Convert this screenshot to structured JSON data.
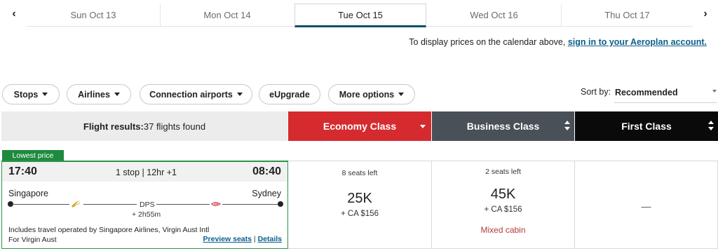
{
  "dates": {
    "prev_icon": "chevron-left-icon",
    "next_icon": "chevron-right-icon",
    "tabs": [
      {
        "label": "Sun Oct 13"
      },
      {
        "label": "Mon Oct 14"
      },
      {
        "label": "Tue Oct 15"
      },
      {
        "label": "Wed Oct 16"
      },
      {
        "label": "Thu Oct 17"
      }
    ],
    "active_index": 2
  },
  "signin": {
    "prefix": "To display prices on the calendar above, ",
    "link": "sign in to your Aeroplan account."
  },
  "filters": {
    "stops": "Stops",
    "airlines": "Airlines",
    "connection": "Connection airports",
    "eupgrade": "eUpgrade",
    "more": "More options"
  },
  "sort": {
    "label": "Sort by:",
    "value": "Recommended"
  },
  "header": {
    "results_label": "Flight results:",
    "results_count": "37 flights found",
    "economy": "Economy Class",
    "business": "Business Class",
    "first": "First Class"
  },
  "colors": {
    "economy": "#d52b2f",
    "business": "#495057",
    "first": "#0a0a0a",
    "lowest_badge": "#1e8a3e",
    "link": "#0b5e8c"
  },
  "flight": {
    "badge": "Lowest price",
    "depart_time": "17:40",
    "arrive_time": "08:40",
    "stops_duration": "1 stop | 12hr +1",
    "origin": "Singapore",
    "destination": "Sydney",
    "connection": "DPS",
    "layover": "+ 2h55m",
    "operated_line1": "Includes travel operated by Singapore Airlines, Virgin Aust Intl",
    "operated_line2": "For Virgin Aust",
    "preview_seats": "Preview seats",
    "separator": "|",
    "details": "Details",
    "economy": {
      "seats": "8 seats left",
      "points": "25K",
      "cash": "+ CA $156"
    },
    "business": {
      "seats": "2 seats left",
      "points": "45K",
      "cash": "+ CA $156",
      "note": "Mixed cabin"
    },
    "first": {
      "value": "—"
    }
  }
}
